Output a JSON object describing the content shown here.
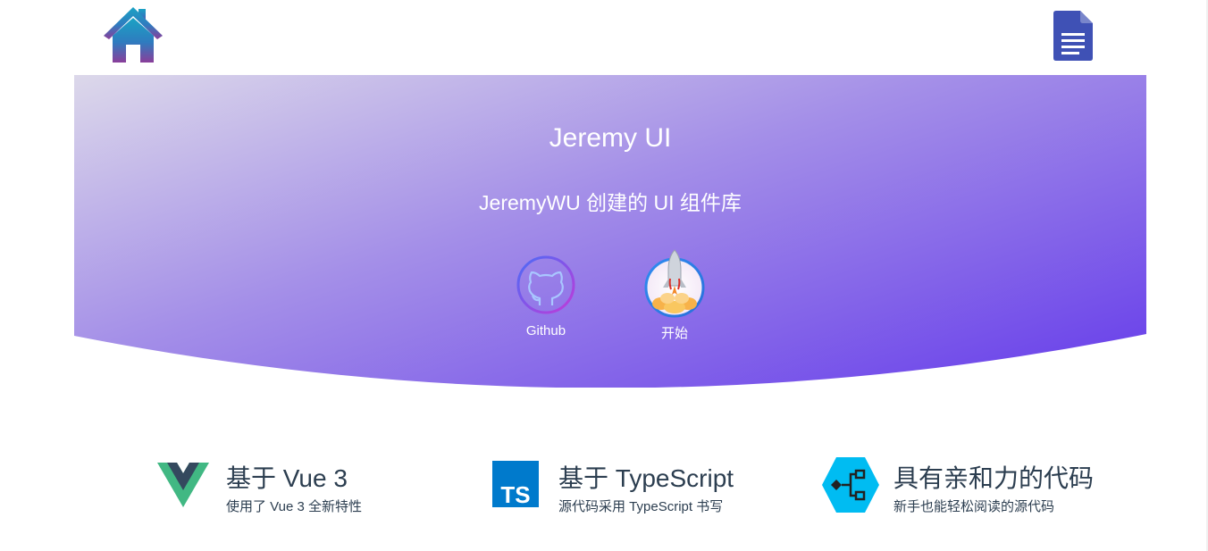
{
  "nav": {
    "home_icon": "house-icon",
    "docs_icon": "document-icon"
  },
  "hero": {
    "title": "Jeremy UI",
    "subtitle": "JeremyWU 创建的 UI 组件库",
    "actions": [
      {
        "label": "Github",
        "icon": "github-icon"
      },
      {
        "label": "开始",
        "icon": "rocket-icon"
      }
    ],
    "gradient_start": "#dcd8ea",
    "gradient_end": "#6a42ea"
  },
  "features": [
    {
      "title": "基于 Vue 3",
      "desc": "使用了 Vue 3 全新特性",
      "icon": "vue-logo-icon"
    },
    {
      "title": "基于 TypeScript",
      "desc": "源代码采用 TypeScript 书写",
      "icon": "typescript-logo-icon"
    },
    {
      "title": "具有亲和力的代码",
      "desc": "新手也能轻松阅读的源代码",
      "icon": "code-flow-icon"
    }
  ]
}
